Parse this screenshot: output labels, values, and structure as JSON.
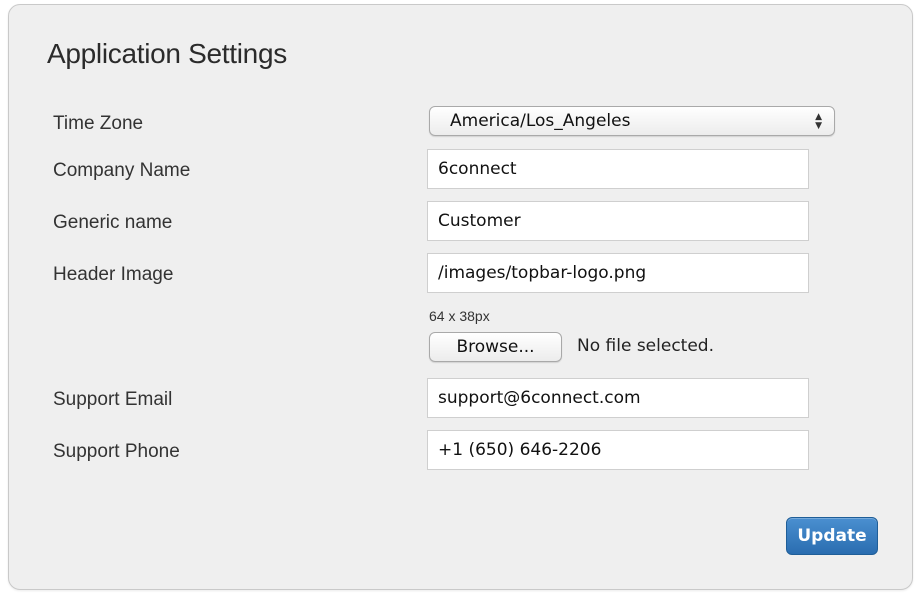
{
  "title": "Application Settings",
  "fields": {
    "time_zone": {
      "label": "Time Zone",
      "selected": "America/Los_Angeles"
    },
    "company_name": {
      "label": "Company Name",
      "value": "6connect"
    },
    "generic_name": {
      "label": "Generic name",
      "value": "Customer"
    },
    "header_image": {
      "label": "Header Image",
      "value": "/images/topbar-logo.png",
      "hint": "64 x 38px",
      "browse_label": "Browse...",
      "file_status": "No file selected."
    },
    "support_email": {
      "label": "Support Email",
      "value": "support@6connect.com"
    },
    "support_phone": {
      "label": "Support Phone",
      "value": "+1 (650) 646-2206"
    }
  },
  "update_label": "Update",
  "colors": {
    "panel_bg": "#efefef",
    "accent": "#2a6db0"
  },
  "icons": {
    "select_arrows": "updown-arrows-icon"
  }
}
